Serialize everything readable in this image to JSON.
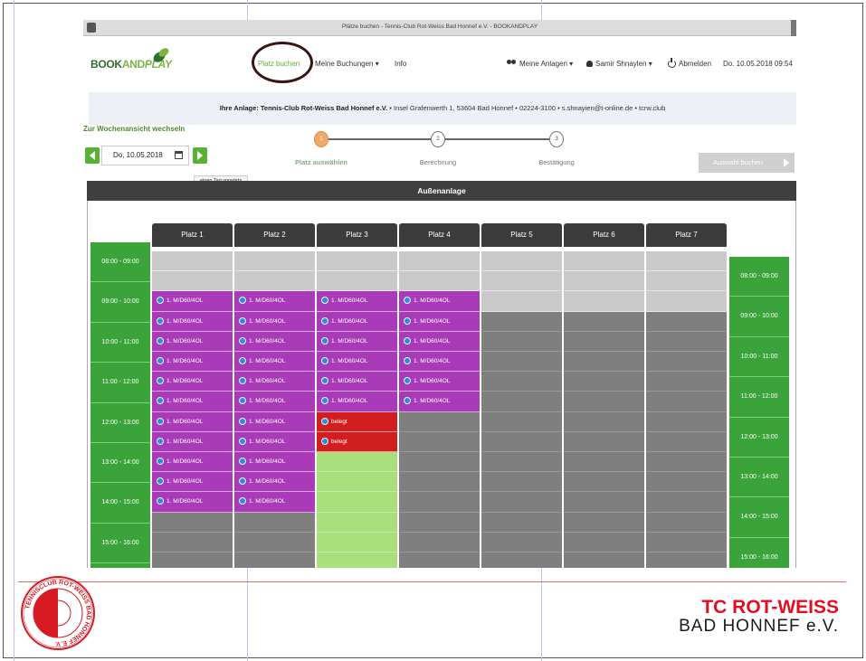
{
  "browser": {
    "window_title": "Plätze buchen - Tennis-Club Rot-Weiss Bad Honnef e.V. - BOOKANDPLAY"
  },
  "nav": {
    "logo_book": "BOOK",
    "logo_and": "AND",
    "logo_play": "PLAY",
    "items": [
      "Platz buchen",
      "Meine Buchungen ▾",
      "Info"
    ],
    "my_facilities": "Meine Anlagen ▾",
    "user": "Samir Shnaylen ▾",
    "logout": "Abmelden",
    "datetime": "Do. 10.05.2018 09:54"
  },
  "info_bar": {
    "label": "Ihre Anlage: Tennis-Club Rot-Weiss Bad Honnef e.V.",
    "details": " • Insel Grafenwerth 1, 53604 Bad Honnef • 02224-3100 • s.shnayien@t-online.de • tcrw.club"
  },
  "week_link": "Zur Wochenansicht wechseln",
  "date_picker": {
    "value": "Do, 10.05.2018",
    "tooltip": "einen Tag vorwärts"
  },
  "steps": [
    {
      "number": "1",
      "label": "Platz auswählen",
      "active": true
    },
    {
      "number": "2",
      "label": "Berechnung",
      "active": false
    },
    {
      "number": "3",
      "label": "Bestätigung",
      "active": false
    }
  ],
  "submit_button": "Auswahl buchen",
  "area_title": "Außenanlage",
  "courts": [
    "Platz 1",
    "Platz 2",
    "Platz 3",
    "Platz 4",
    "Platz 5",
    "Platz 6",
    "Platz 7"
  ],
  "times": [
    "08:00 - 09:00",
    "09:00 - 10:00",
    "10:00 - 11:00",
    "11:00 - 12:00",
    "12:00 - 13:00",
    "13:00 - 14:00",
    "14:00 - 15:00",
    "15:00 - 16:00"
  ],
  "booking_label": "1. M/D60/4OL",
  "blocked_label": "belegt",
  "grid": [
    [
      "free",
      "free",
      "free",
      "free",
      "free",
      "free",
      "free"
    ],
    [
      "free",
      "free",
      "free",
      "free",
      "free",
      "free",
      "free"
    ],
    [
      "booked",
      "booked",
      "booked",
      "booked",
      "free",
      "free",
      "free"
    ],
    [
      "booked",
      "booked",
      "booked",
      "booked",
      "gray",
      "gray",
      "gray"
    ],
    [
      "booked",
      "booked",
      "booked",
      "booked",
      "gray",
      "gray",
      "gray"
    ],
    [
      "booked",
      "booked",
      "booked",
      "booked",
      "gray",
      "gray",
      "gray"
    ],
    [
      "booked",
      "booked",
      "booked",
      "booked",
      "gray",
      "gray",
      "gray"
    ],
    [
      "booked",
      "booked",
      "booked",
      "booked",
      "gray",
      "gray",
      "gray"
    ],
    [
      "booked",
      "booked",
      "blocked",
      "gray",
      "gray",
      "gray",
      "gray"
    ],
    [
      "booked",
      "booked",
      "blocked",
      "gray",
      "gray",
      "gray",
      "gray"
    ],
    [
      "booked",
      "booked",
      "green",
      "gray",
      "gray",
      "gray",
      "gray"
    ],
    [
      "booked",
      "booked",
      "green",
      "gray",
      "gray",
      "gray",
      "gray"
    ],
    [
      "booked",
      "booked",
      "green",
      "gray",
      "gray",
      "gray",
      "gray"
    ],
    [
      "gray",
      "gray",
      "green",
      "gray",
      "gray",
      "gray",
      "gray"
    ],
    [
      "gray",
      "gray",
      "green",
      "gray",
      "gray",
      "gray",
      "gray"
    ],
    [
      "gray",
      "gray",
      "green",
      "gray",
      "gray",
      "gray",
      "gray"
    ]
  ],
  "club": {
    "line1": "TC ROT-WEISS",
    "line2": "BAD HONNEF e.V."
  },
  "seal_text": "TENNISCLUB ROT-WEISS BAD HONNEF E.V.",
  "colors": {
    "green": "#58b233",
    "booked": "#a93ab8",
    "blocked": "#d11f1f",
    "free_slot": "#a9e07c",
    "club_red": "#e00f22"
  }
}
